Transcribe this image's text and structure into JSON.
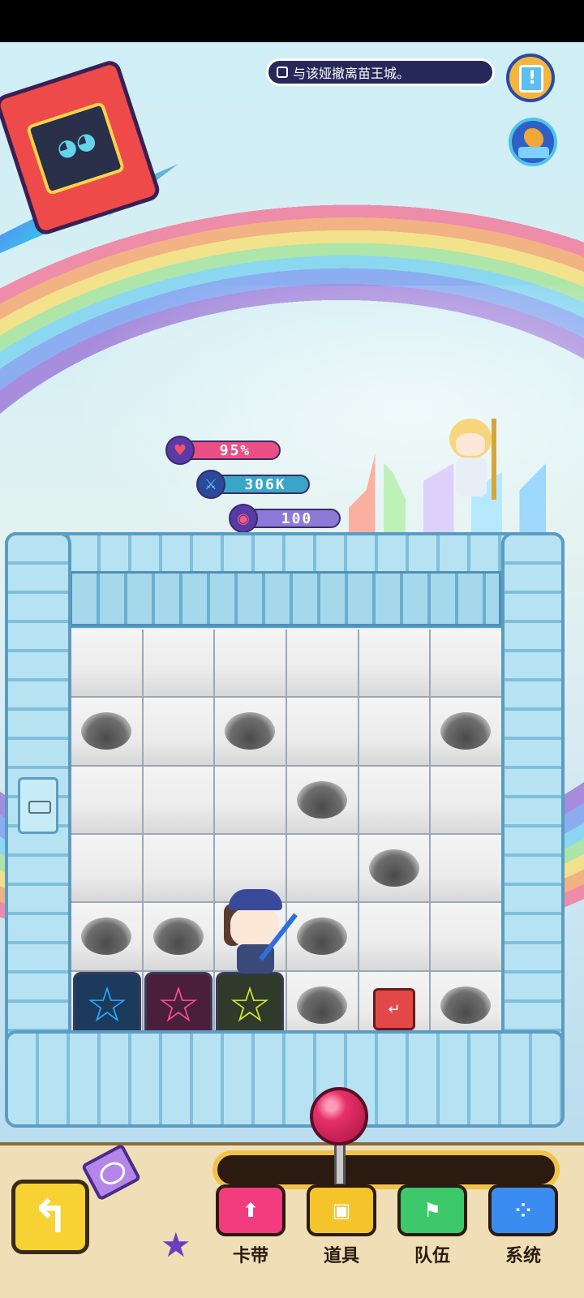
{
  "quest": {
    "text": "与该娅撤离苗王城。"
  },
  "stats": {
    "hp": "95%",
    "attack": "306K",
    "energy": "100"
  },
  "grid": {
    "rows": 6,
    "cols": 6,
    "holes": [
      [
        false,
        false,
        false,
        false,
        false,
        false
      ],
      [
        true,
        false,
        true,
        false,
        false,
        true
      ],
      [
        false,
        false,
        false,
        true,
        false,
        false
      ],
      [
        false,
        false,
        false,
        false,
        true,
        false
      ],
      [
        true,
        true,
        false,
        true,
        false,
        false
      ],
      [
        false,
        false,
        false,
        true,
        false,
        true
      ]
    ]
  },
  "cards": [
    {
      "color": "#2ea9ff",
      "icon": "star-outline"
    },
    {
      "color": "#ff4e94",
      "icon": "star-outline"
    },
    {
      "color": "#d7e834",
      "icon": "star-outline"
    }
  ],
  "menu": {
    "card": "卡带",
    "item": "道具",
    "team": "队伍",
    "system": "系统"
  },
  "colors": {
    "accent_pink": "#f23c7d",
    "accent_yellow": "#f5c32a",
    "accent_green": "#3cc86b",
    "accent_blue": "#3a8cf0"
  }
}
